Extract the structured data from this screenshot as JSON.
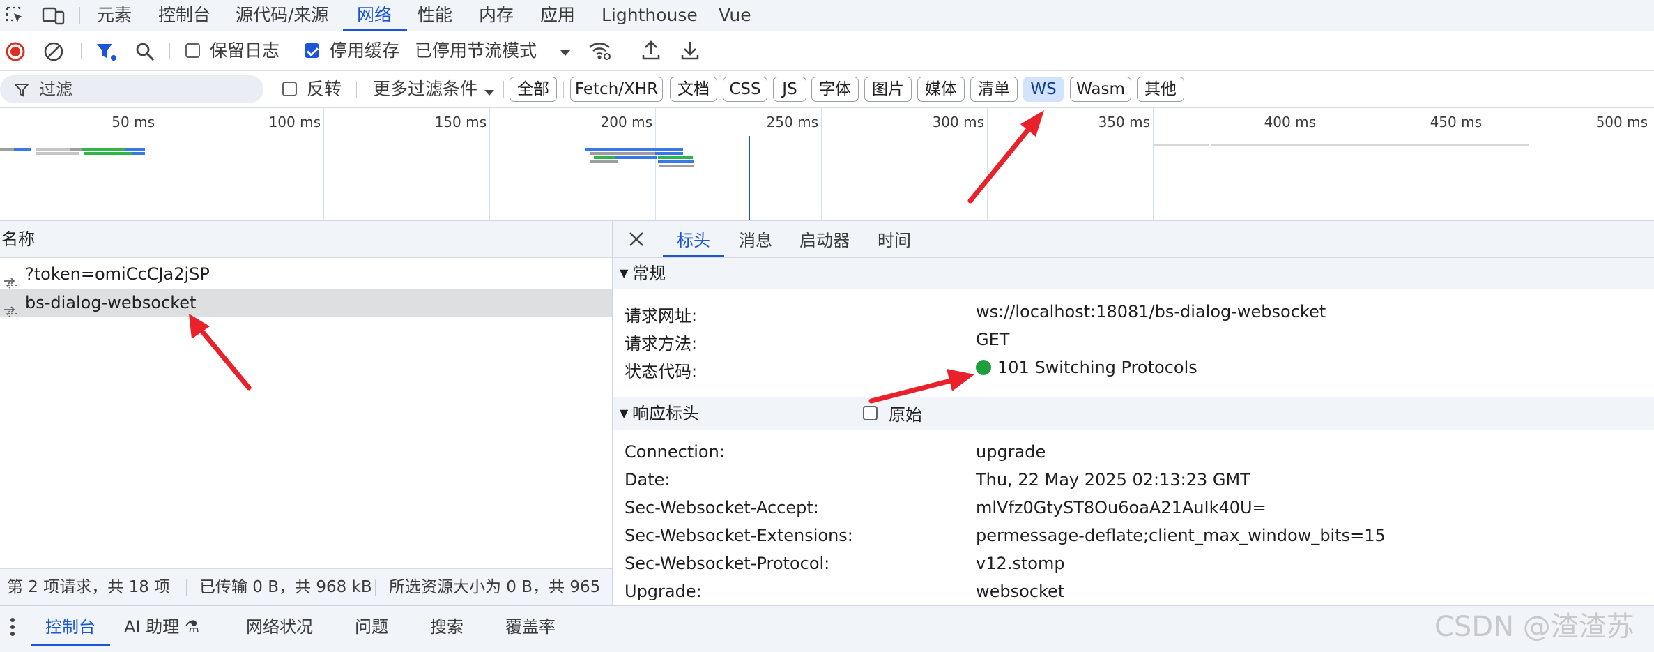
{
  "top_tabs": [
    "元素",
    "控制台",
    "源代码/来源",
    "网络",
    "性能",
    "内存",
    "应用",
    "Lighthouse",
    "Vue"
  ],
  "toolbar": {
    "preserve_log": "保留日志",
    "disable_cache": "停用缓存",
    "throttle": "已停用节流模式"
  },
  "filter": {
    "placeholder": "过滤",
    "invert": "反转",
    "more_filters": "更多过滤条件",
    "chips": [
      "全部",
      "Fetch/XHR",
      "文档",
      "CSS",
      "JS",
      "字体",
      "图片",
      "媒体",
      "清单",
      "WS",
      "Wasm",
      "其他"
    ],
    "active_chip": "WS"
  },
  "timeline": {
    "ticks": [
      "50 ms",
      "100 ms",
      "150 ms",
      "200 ms",
      "250 ms",
      "300 ms",
      "350 ms",
      "400 ms",
      "450 ms",
      "500 ms"
    ]
  },
  "request_list": {
    "header": "名称",
    "rows": [
      "?token=omiCcCJa2jSP",
      "bs-dialog-websocket"
    ],
    "selected_index": 1,
    "status": {
      "count": "第 2 项请求，共 18 项",
      "transferred": "已传输 0 B，共 968 kB",
      "resources": "所选资源大小为 0 B，共 965"
    }
  },
  "details": {
    "tabs": [
      "标头",
      "消息",
      "启动器",
      "时间"
    ],
    "active_tab": "标头",
    "general": {
      "title": "常规",
      "rows": [
        {
          "k": "请求网址:",
          "v": "ws://localhost:18081/bs-dialog-websocket"
        },
        {
          "k": "请求方法:",
          "v": "GET"
        },
        {
          "k": "状态代码:",
          "v": "101 Switching Protocols"
        }
      ],
      "status_color": "#1e9e3e"
    },
    "response": {
      "title": "响应标头",
      "raw_label": "原始",
      "rows": [
        {
          "k": "Connection:",
          "v": "upgrade"
        },
        {
          "k": "Date:",
          "v": "Thu, 22 May 2025 02:13:23 GMT"
        },
        {
          "k": "Sec-Websocket-Accept:",
          "v": "mlVfz0GtyST8Ou6oaA21AuIk40U="
        },
        {
          "k": "Sec-Websocket-Extensions:",
          "v": "permessage-deflate;client_max_window_bits=15"
        },
        {
          "k": "Sec-Websocket-Protocol:",
          "v": "v12.stomp"
        },
        {
          "k": "Upgrade:",
          "v": "websocket"
        }
      ]
    }
  },
  "drawer": {
    "tabs": [
      "控制台",
      "AI 助理 ⚗",
      "网络状况",
      "问题",
      "搜索",
      "覆盖率"
    ],
    "active_tab": "控制台"
  },
  "watermark": "CSDN @渣渣苏",
  "colors": {
    "accent": "#1a57d6",
    "record": "#d93025",
    "annotation": "#e8212b"
  }
}
